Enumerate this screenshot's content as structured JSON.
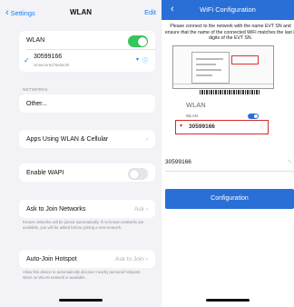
{
  "left": {
    "back_label": "Settings",
    "title": "WLAN",
    "edit_label": "Edit",
    "wlan_label": "WLAN",
    "network": {
      "name": "30599166",
      "status": "Unsecured Network"
    },
    "networks_header": "NETWORKS",
    "other_label": "Other...",
    "apps_label": "Apps Using WLAN & Cellular",
    "wapi_label": "Enable WAPI",
    "ask_join_label": "Ask to Join Networks",
    "ask_join_value": "Ask",
    "ask_join_note": "Known networks will be joined automatically. If no known networks are available, you will be asked before joining a new network.",
    "auto_join_label": "Auto-Join Hotspot",
    "auto_join_value": "Ask to Join",
    "auto_join_note": "Allow this device to automatically discover nearby personal hotspots when no WLAN network is available.",
    "wlan_on": true,
    "wapi_on": false
  },
  "right": {
    "title": "WiFi Configuration",
    "instruction": "Please connect to the network with the name EVT SN and ensure that the name of the connected WiFi matches the last 8 digits of the EVT SN.",
    "mini_wlan_title": "WLAN",
    "mini_wlan_row": "WLAN",
    "mini_network_name": "30599166",
    "ssid_value": "30599166",
    "configure_label": "Configuration"
  },
  "colors": {
    "ios_blue": "#0a84ff",
    "ios_green": "#34c759",
    "app_blue": "#2a6fd6",
    "highlight_red": "#d32b2b"
  }
}
